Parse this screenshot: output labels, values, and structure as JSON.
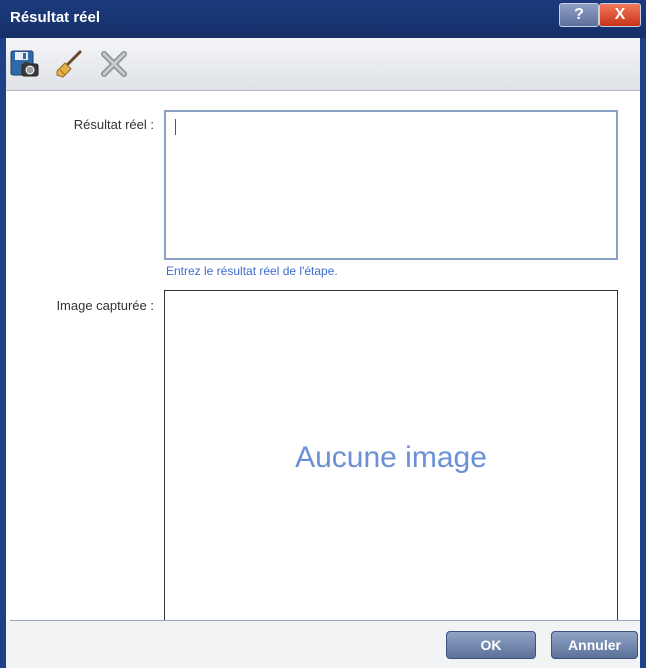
{
  "window": {
    "title": "Résultat réel",
    "help_label": "?",
    "close_label": "X"
  },
  "toolbar": {
    "icons": [
      "save-screenshot-icon",
      "clear-brush-icon",
      "delete-icon"
    ]
  },
  "form": {
    "actual_result_label": "Résultat réel :",
    "actual_result_value": "",
    "actual_result_hint": "Entrez le résultat réel de l'étape.",
    "captured_image_label": "Image capturée :",
    "no_image_text": "Aucune image"
  },
  "footer": {
    "ok_label": "OK",
    "cancel_label": "Annuler"
  },
  "colors": {
    "titlebar": "#1c3a7c",
    "accent_text": "#3b6ccf",
    "button": "#6e84aa"
  }
}
